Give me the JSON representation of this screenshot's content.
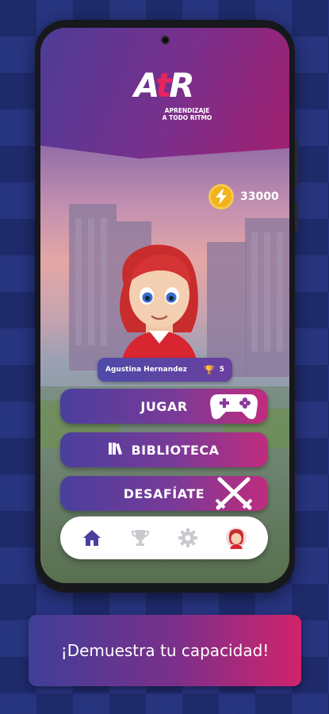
{
  "app": {
    "logo_text_a": "A",
    "logo_text_t": "t",
    "logo_text_r": "R",
    "logo_tagline_1": "APRENDIZAJE",
    "logo_tagline_2": "A TODO RITMO"
  },
  "energy": {
    "icon": "lightning-bolt-icon",
    "value": "33000",
    "color": "#f2b21c"
  },
  "player": {
    "name": "Agustina Hernandez",
    "trophies": "5",
    "trophy_icon": "trophy-icon"
  },
  "menu": {
    "play_label": "JUGAR",
    "play_icon": "gamepad-icon",
    "library_label": "BIBLIOTECA",
    "library_icon": "books-icon",
    "challenge_label": "DESAFÍATE",
    "challenge_icon": "crossed-swords-icon"
  },
  "nav": {
    "items": [
      {
        "name": "home",
        "icon": "home-icon",
        "active": true
      },
      {
        "name": "trophies",
        "icon": "trophy-icon",
        "active": false
      },
      {
        "name": "settings",
        "icon": "gear-icon",
        "active": false
      },
      {
        "name": "profile",
        "icon": "avatar-icon",
        "active": false
      }
    ],
    "active_color": "#4a3f9e",
    "inactive_color": "#c9c9cf"
  },
  "banner": {
    "text": "¡Demuestra tu capacidad!"
  },
  "colors": {
    "brand_purple": "#4a3f9e",
    "brand_pink": "#d2236b"
  }
}
